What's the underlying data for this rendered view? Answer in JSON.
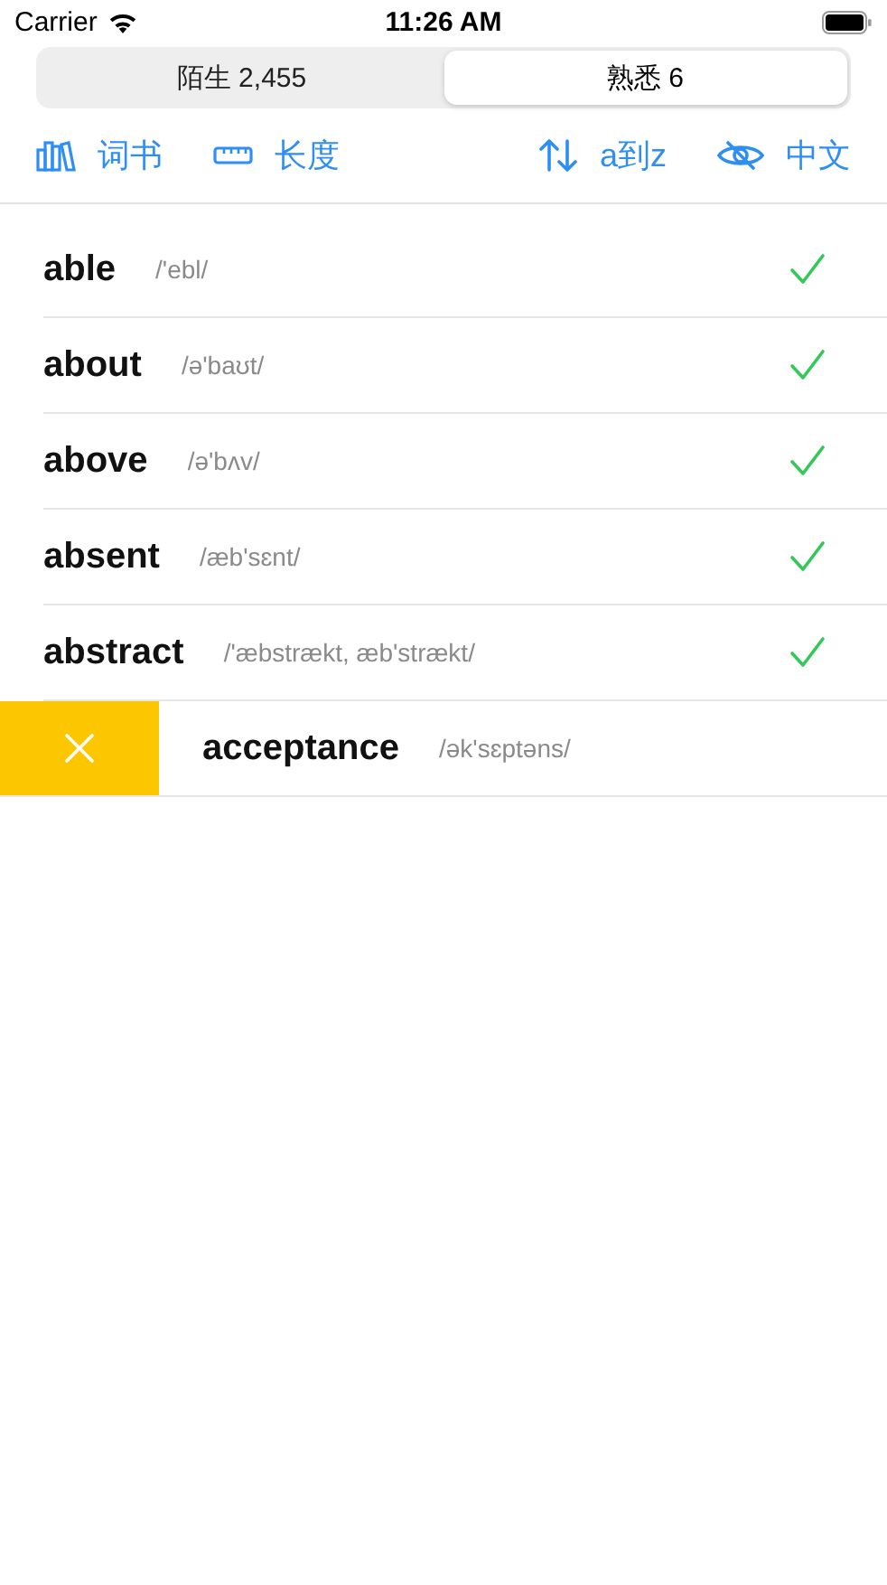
{
  "status_bar": {
    "carrier": "Carrier",
    "time": "11:26 AM"
  },
  "segments": [
    {
      "label": "陌生 2,455",
      "selected": false
    },
    {
      "label": "熟悉 6",
      "selected": true
    }
  ],
  "toolbar": [
    {
      "kind": "books",
      "label": "词书"
    },
    {
      "kind": "ruler",
      "label": "长度"
    },
    {
      "kind": "sort",
      "label": "a到z"
    },
    {
      "kind": "eye",
      "label": "中文"
    }
  ],
  "words": [
    {
      "word": "able",
      "phonetic": "/'ebl/",
      "swiped": false
    },
    {
      "word": "about",
      "phonetic": "/ə'baʊt/",
      "swiped": false
    },
    {
      "word": "above",
      "phonetic": "/ə'bʌv/",
      "swiped": false
    },
    {
      "word": "absent",
      "phonetic": "/æb'sɛnt/",
      "swiped": false
    },
    {
      "word": "abstract",
      "phonetic": "/'æbstrækt, æb'strækt/",
      "swiped": false
    },
    {
      "word": "acceptance",
      "phonetic": "/ək'sɛptəns/",
      "swiped": true
    }
  ]
}
